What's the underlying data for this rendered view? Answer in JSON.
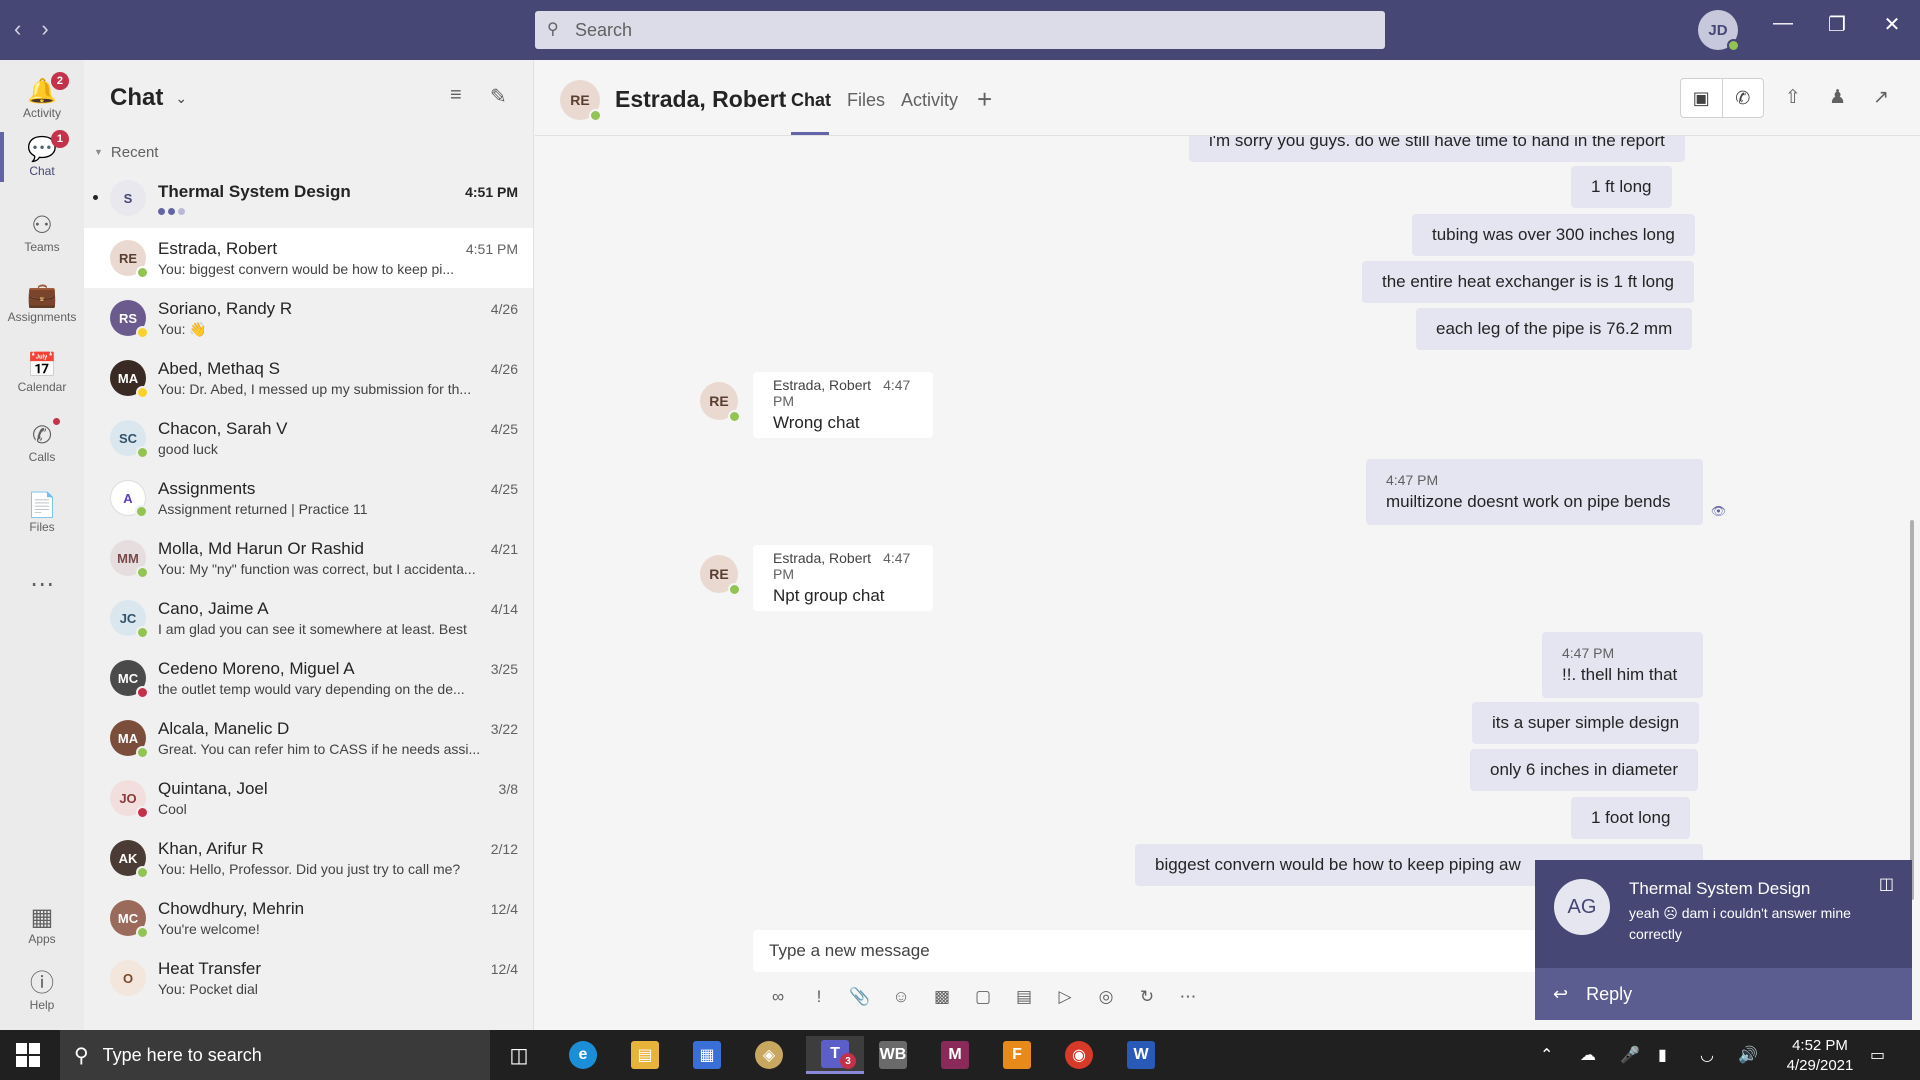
{
  "titlebar": {
    "search_placeholder": "Search",
    "user_initials": "JD",
    "controls": [
      "minimize",
      "maximize",
      "close"
    ]
  },
  "rail": [
    {
      "label": "Activity",
      "icon": "bell-icon",
      "badge": "2"
    },
    {
      "label": "Chat",
      "icon": "chat-icon",
      "badge": "1",
      "active": true
    },
    {
      "label": "Teams",
      "icon": "teams-icon"
    },
    {
      "label": "Assignments",
      "icon": "backpack-icon"
    },
    {
      "label": "Calendar",
      "icon": "calendar-icon"
    },
    {
      "label": "Calls",
      "icon": "phone-icon"
    },
    {
      "label": "Files",
      "icon": "file-icon"
    },
    {
      "label": "Apps",
      "icon": "apps-icon"
    },
    {
      "label": "Help",
      "icon": "help-icon"
    }
  ],
  "chatlist": {
    "title": "Chat",
    "section": "Recent",
    "items": [
      {
        "initials": "S",
        "name": "Thermal System Design",
        "time": "4:51 PM",
        "preview": "",
        "unread": true
      },
      {
        "initials": "RE",
        "name": "Estrada, Robert",
        "time": "4:51 PM",
        "preview": "You: biggest convern would be how to keep pi...",
        "selected": true
      },
      {
        "initials": "RS",
        "name": "Soriano, Randy R",
        "time": "4/26",
        "preview": "You: 👋"
      },
      {
        "initials": "MA",
        "name": "Abed, Methaq S",
        "time": "4/26",
        "preview": "You: Dr. Abed, I messed up my submission for th..."
      },
      {
        "initials": "SC",
        "name": "Chacon, Sarah V",
        "time": "4/25",
        "preview": "good luck"
      },
      {
        "initials": "A",
        "name": "Assignments",
        "time": "4/25",
        "preview": "Assignment returned | Practice 11"
      },
      {
        "initials": "MM",
        "name": "Molla, Md Harun Or Rashid",
        "time": "4/21",
        "preview": "You: My \"ny\" function was correct, but I accidenta..."
      },
      {
        "initials": "JC",
        "name": "Cano, Jaime A",
        "time": "4/14",
        "preview": "I am glad you can see it somewhere at least. Best"
      },
      {
        "initials": "MC",
        "name": "Cedeno Moreno, Miguel A",
        "time": "3/25",
        "preview": "the outlet temp would vary depending on the de..."
      },
      {
        "initials": "MA",
        "name": "Alcala, Manelic D",
        "time": "3/22",
        "preview": "Great. You can refer him to CASS if he needs assi..."
      },
      {
        "initials": "JO",
        "name": "Quintana, Joel",
        "time": "3/8",
        "preview": "Cool"
      },
      {
        "initials": "AK",
        "name": "Khan, Arifur R",
        "time": "2/12",
        "preview": "You: Hello, Professor. Did you just try to call me?"
      },
      {
        "initials": "MC",
        "name": "Chowdhury, Mehrin",
        "time": "12/4",
        "preview": "You're welcome!"
      },
      {
        "initials": "O",
        "name": "Heat Transfer",
        "time": "12/4",
        "preview": "You: Pocket dial"
      }
    ]
  },
  "conversation": {
    "initials": "RE",
    "name": "Estrada, Robert",
    "tabs": [
      "Chat",
      "Files",
      "Activity"
    ],
    "messages": {
      "m1": "i'm sorry you guys. do we still have time to hand in the report",
      "m2": "1 ft long",
      "m3": "tubing was over 300 inches long",
      "m4": "the entire heat exchanger is is 1 ft long",
      "m5": "each  leg of the pipe is 76.2 mm",
      "r1_sender": "Estrada, Robert",
      "r1_time": "4:47 PM",
      "r1_text": "Wrong chat",
      "m6_time": "4:47 PM",
      "m6_text": "muiltizone doesnt work on pipe bends",
      "r2_sender": "Estrada, Robert",
      "r2_time": "4:47 PM",
      "r2_text": "Npt group chat",
      "m7_time": "4:47 PM",
      "m7_text": "!!. thell him that",
      "m8": "its a super simple design",
      "m9": "only 6 inches in diameter",
      "m10": "1 foot long",
      "m11": "biggest convern would be how to keep piping aw"
    },
    "compose_placeholder": "Type a new message"
  },
  "toast": {
    "initials": "AG",
    "title": "Thermal System Design",
    "body": "yeah ☹ dam i couldn't answer mine correctly",
    "reply": "Reply"
  },
  "taskbar": {
    "search_placeholder": "Type here to search",
    "teams_badge": "3",
    "time": "4:52 PM",
    "date": "4/29/2021"
  }
}
